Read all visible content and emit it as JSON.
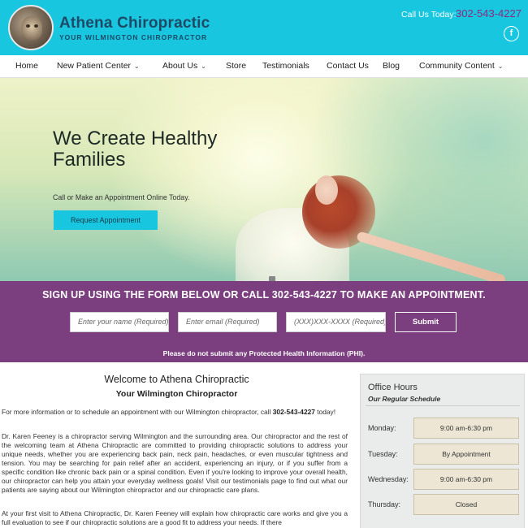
{
  "header": {
    "brand_name": "Athena Chiropractic",
    "brand_tagline": "YOUR WILMINGTON CHIROPRACTOR",
    "call_label": "Call Us Today:",
    "call_phone": "302-543-4227",
    "facebook_icon": "f",
    "colors": {
      "bar": "#18c6e0",
      "brand_text": "#1e4a66",
      "phone": "#8c2c7c"
    }
  },
  "nav": {
    "items": [
      {
        "label": "Home",
        "has_dropdown": false
      },
      {
        "label": "New Patient Center",
        "has_dropdown": true
      },
      {
        "label": "About Us",
        "has_dropdown": true
      },
      {
        "label": "Store",
        "has_dropdown": false
      },
      {
        "label": "Testimonials",
        "has_dropdown": false
      },
      {
        "label": "Contact Us",
        "has_dropdown": false
      },
      {
        "label": "Blog",
        "has_dropdown": false
      },
      {
        "label": "Community Content",
        "has_dropdown": true
      }
    ],
    "dropdown_glyph": "⌄"
  },
  "hero": {
    "title": "We Create Healthy Families",
    "subtitle": "Call or Make an Appointment Online Today.",
    "button": "Request Appointment"
  },
  "signup": {
    "title": "SIGN UP USING THE FORM BELOW OR CALL 302-543-4227 TO MAKE AN APPOINTMENT.",
    "name_placeholder": "Enter your name (Required)",
    "email_placeholder": "Enter email (Required)",
    "phone_placeholder": "(XXX)XXX-XXXX (Required)",
    "submit": "Submit",
    "note": "Please do not submit any Protected Health Information (PHI).",
    "color": "#7b3f7f"
  },
  "main": {
    "title": "Welcome to Athena Chiropractic",
    "subtitle": "Your Wilmington Chiropractor",
    "para1_text": "For more information or to schedule an appointment with our Wilmington chiropractor, call ",
    "para1_phone": "302-543-4227",
    "para1_end": " today!",
    "para2": "Dr. Karen Feeney is a chiropractor serving Wilmington and the surrounding area. Our chiropractor and the rest of the welcoming team at Athena Chiropractic are committed to providing chiropractic solutions to address your unique needs, whether you are experiencing back pain, neck pain, headaches, or even muscular tightness and tension. You may be searching for pain relief after an accident, experiencing an injury, or if you suffer from a specific condition like chronic back pain or a spinal condition. Even if you're looking to improve your overall health, our chiropractor can help you attain your everyday wellness goals! Visit our testimonials page to find out what our patients are saying about our Wilmington chiropractor and our chiropractic care plans.",
    "para3": "At your first visit to Athena Chiropractic, Dr. Karen Feeney will explain how chiropractic care works and give you a full evaluation to see if our chiropractic solutions are a good fit to address your needs. If there"
  },
  "hours": {
    "title": "Office Hours",
    "subtitle": "Our Regular Schedule",
    "rows": [
      {
        "day": "Monday:",
        "time": "9:00 am-6:30 pm"
      },
      {
        "day": "Tuesday:",
        "time": "By Appointment"
      },
      {
        "day": "Wednesday:",
        "time": "9:00 am-6:30 pm"
      },
      {
        "day": "Thursday:",
        "time": "Closed"
      }
    ]
  }
}
